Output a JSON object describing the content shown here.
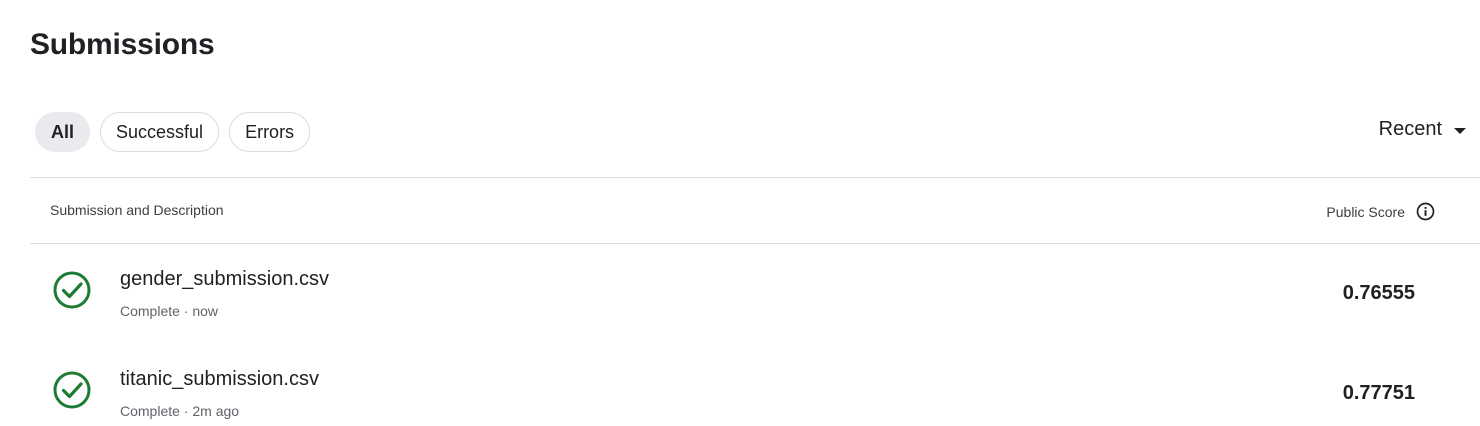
{
  "page": {
    "title": "Submissions"
  },
  "filters": {
    "all": "All",
    "successful": "Successful",
    "errors": "Errors"
  },
  "sort": {
    "label": "Recent"
  },
  "table": {
    "header_description": "Submission and Description",
    "header_score": "Public Score",
    "rows": [
      {
        "name": "gender_submission.csv",
        "status": "Complete · now",
        "score": "0.76555"
      },
      {
        "name": "titanic_submission.csv",
        "status": "Complete · 2m ago",
        "score": "0.77751"
      }
    ]
  },
  "colors": {
    "success": "#1e7b34",
    "chip_active_bg": "#e8eaed",
    "border": "#dadce0"
  },
  "icons": {
    "status": "check-circle-icon",
    "info": "info-icon",
    "sort": "caret-down-icon"
  }
}
